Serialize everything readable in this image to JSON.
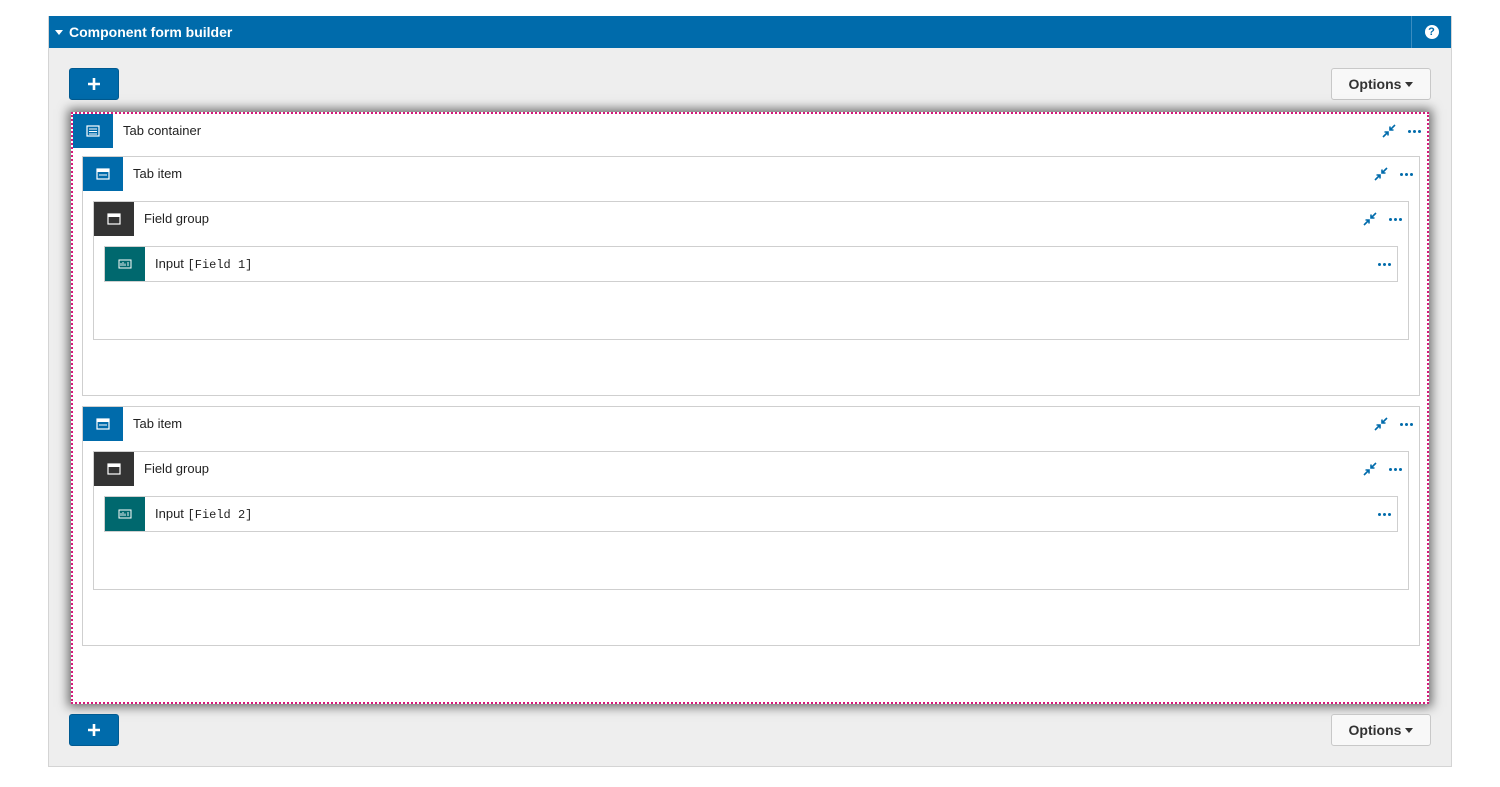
{
  "panel": {
    "title": "Component form builder",
    "help_icon": "?"
  },
  "toolbar": {
    "add_icon": "plus-icon",
    "options_label": "Options"
  },
  "colors": {
    "primary": "#006bab",
    "field_group": "#333333",
    "input": "#00686e",
    "selection": "#d6197a"
  },
  "tree": {
    "container_label": "Tab container",
    "tabs": [
      {
        "label": "Tab item",
        "group_label": "Field group",
        "input_label": "Input",
        "input_field": "[Field 1]"
      },
      {
        "label": "Tab item",
        "group_label": "Field group",
        "input_label": "Input",
        "input_field": "[Field 2]"
      }
    ]
  }
}
